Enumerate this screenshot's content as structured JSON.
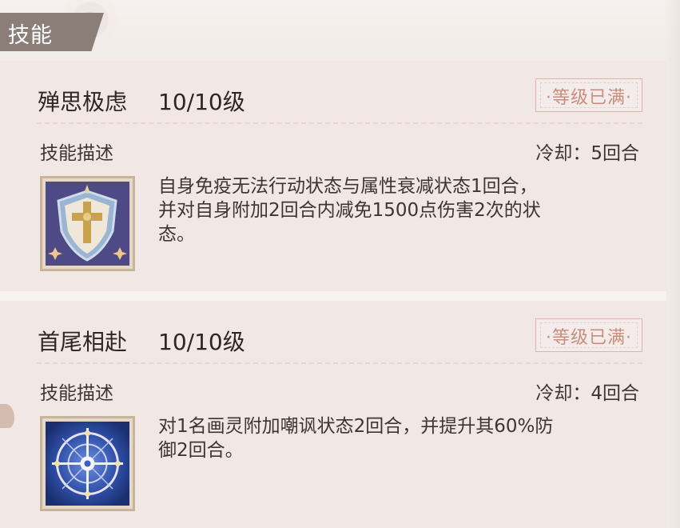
{
  "header": {
    "tab_label": "技能"
  },
  "skills": [
    {
      "name": "殚思极虑",
      "level": "10/10级",
      "badge": "·等级已满·",
      "desc_label": "技能描述",
      "cooldown": "冷却：5回合",
      "description_lines": [
        "自身免疫无法行动状态与属性衰减状态1回合，",
        "并对自身附加2回合内减免1500点伤害2次的状",
        "态。"
      ],
      "icon": "shield-cross-icon"
    },
    {
      "name": "首尾相赴",
      "level": "10/10级",
      "badge": "·等级已满·",
      "desc_label": "技能描述",
      "cooldown": "冷却：4回合",
      "description_lines": [
        "对1名画灵附加嘲讽状态2回合，并提升其60%防",
        "御2回合。"
      ],
      "icon": "compass-rose-icon"
    }
  ],
  "colors": {
    "tab_bg": "#8b7e79",
    "badge_text": "#c98d7c",
    "panel_bg": "#f1e8e6",
    "icon1_bg": "#4e4a86",
    "icon2_bg": "#27459c"
  }
}
